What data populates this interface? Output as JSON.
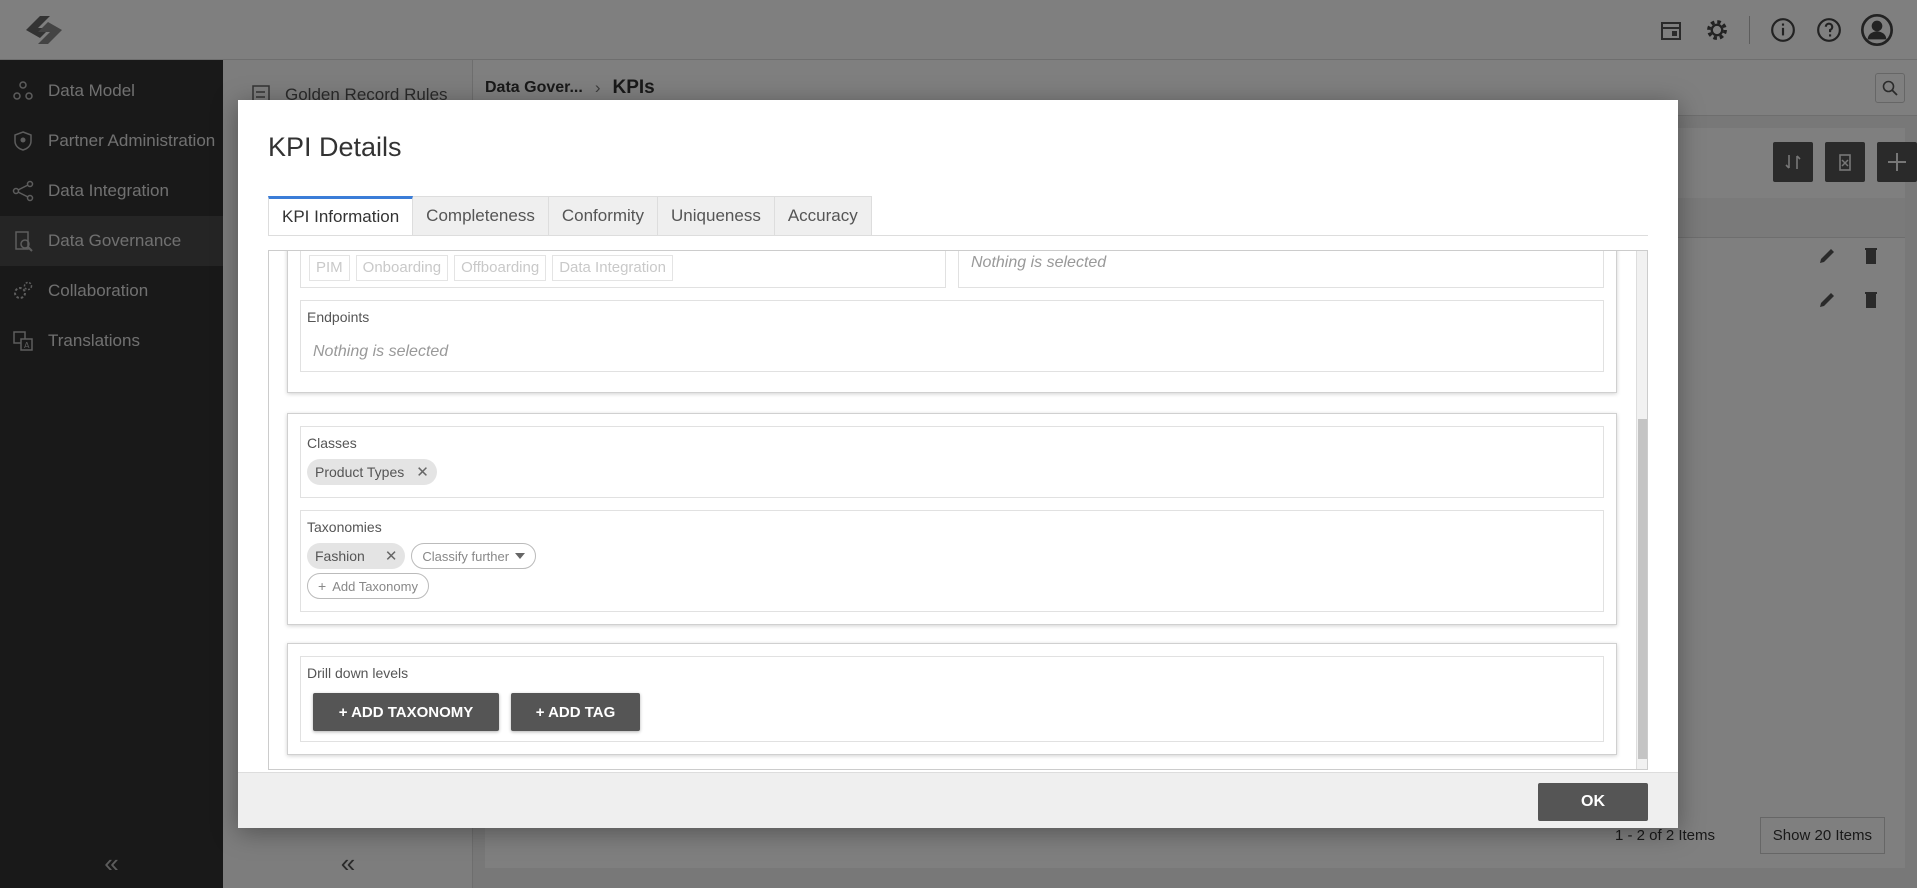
{
  "sidebar": {
    "items": [
      {
        "label": "Data Model",
        "icon": "data-model-icon"
      },
      {
        "label": "Partner Administration",
        "icon": "shield-icon"
      },
      {
        "label": "Data Integration",
        "icon": "share-nodes-icon"
      },
      {
        "label": "Data Governance",
        "icon": "governance-icon"
      },
      {
        "label": "Collaboration",
        "icon": "gears-icon"
      },
      {
        "label": "Translations",
        "icon": "translate-icon"
      }
    ],
    "active_index": 3
  },
  "subpanel": {
    "item": "Golden Record Rules"
  },
  "breadcrumb": {
    "parent": "Data Gover...",
    "current": "KPIs"
  },
  "pager": {
    "info": "1 - 2 of 2 Items",
    "show_label": "Show 20 Items"
  },
  "modal": {
    "title": "KPI Details",
    "tabs": [
      "KPI Information",
      "Completeness",
      "Conformity",
      "Uniqueness",
      "Accuracy"
    ],
    "active_tab": 0,
    "top_chips": [
      "PIM",
      "Onboarding",
      "Offboarding",
      "Data Integration"
    ],
    "top_right_placeholder": "Nothing is selected",
    "endpoints": {
      "label": "Endpoints",
      "placeholder": "Nothing is selected"
    },
    "classes": {
      "label": "Classes",
      "chip": "Product Types"
    },
    "taxonomies": {
      "label": "Taxonomies",
      "chip": "Fashion",
      "classify_label": "Classify further",
      "add_label": "Add Taxonomy"
    },
    "drilldown": {
      "label": "Drill down levels",
      "add_taxonomy": "+ ADD TAXONOMY",
      "add_tag": "+ ADD TAG"
    },
    "ok_label": "OK"
  },
  "colors": {
    "accent": "#3b7dd8",
    "sidebar_bg": "#333333",
    "button_dark": "#555555"
  }
}
